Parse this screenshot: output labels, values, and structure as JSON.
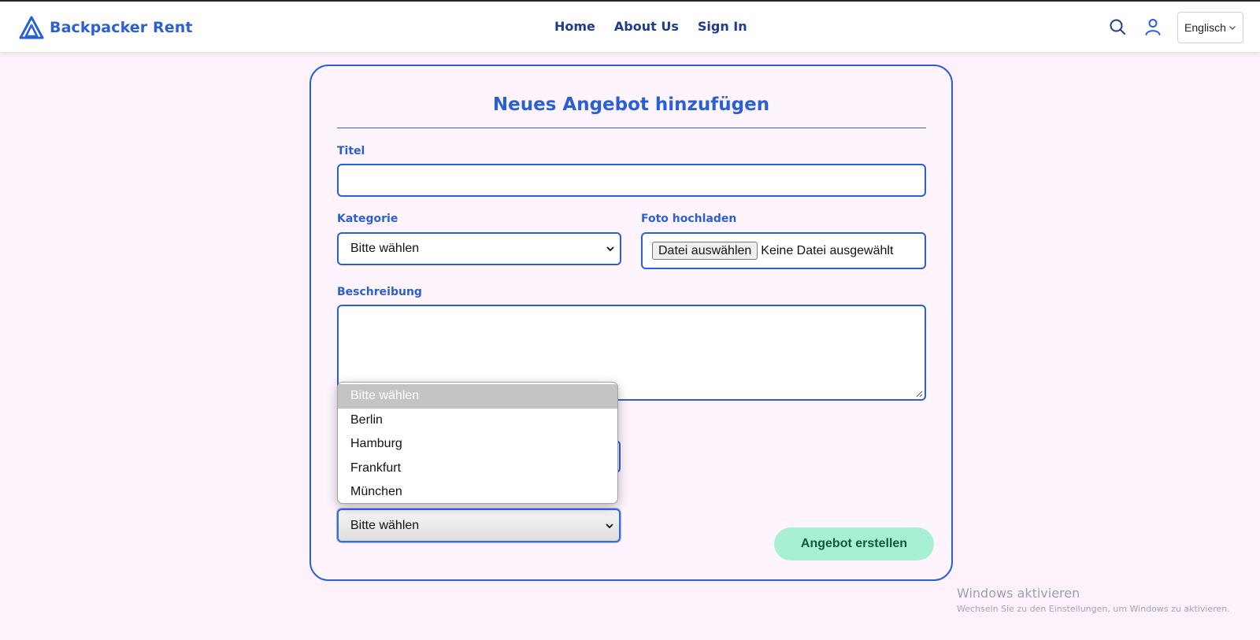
{
  "navbar": {
    "brand_name": "Backpacker Rent",
    "links": [
      "Home",
      "About Us",
      "Sign In"
    ],
    "language_label": "Englisch",
    "icons": [
      "logo-triangle-icon",
      "search-icon",
      "user-icon",
      "chevron-down-icon"
    ]
  },
  "form": {
    "title": "Neues Angebot hinzufügen",
    "title_label": "Titel",
    "title_value": "",
    "category_label": "Kategorie",
    "category_value": "Bitte wählen",
    "photo_label": "Foto hochladen",
    "photo_button": "Datei auswählen",
    "photo_status": "Keine Datei ausgewählt",
    "description_label": "Beschreibung",
    "description_value": "",
    "city_value": "Bitte wählen",
    "submit_label": "Angebot erstellen"
  },
  "dropdown": {
    "options": [
      "Bitte wählen",
      "Berlin",
      "Hamburg",
      "Frankfurt",
      "München"
    ],
    "selected_index": 0
  },
  "watermark": {
    "title": "Windows aktivieren",
    "subtitle": "Wechseln Sie zu den Einstellungen, um Windows zu aktivieren."
  },
  "colors": {
    "accent": "#2b5fd6",
    "page_background": "#fdf2fc",
    "submit_background": "#a8f0d4",
    "submit_text": "#0f5a3c"
  }
}
